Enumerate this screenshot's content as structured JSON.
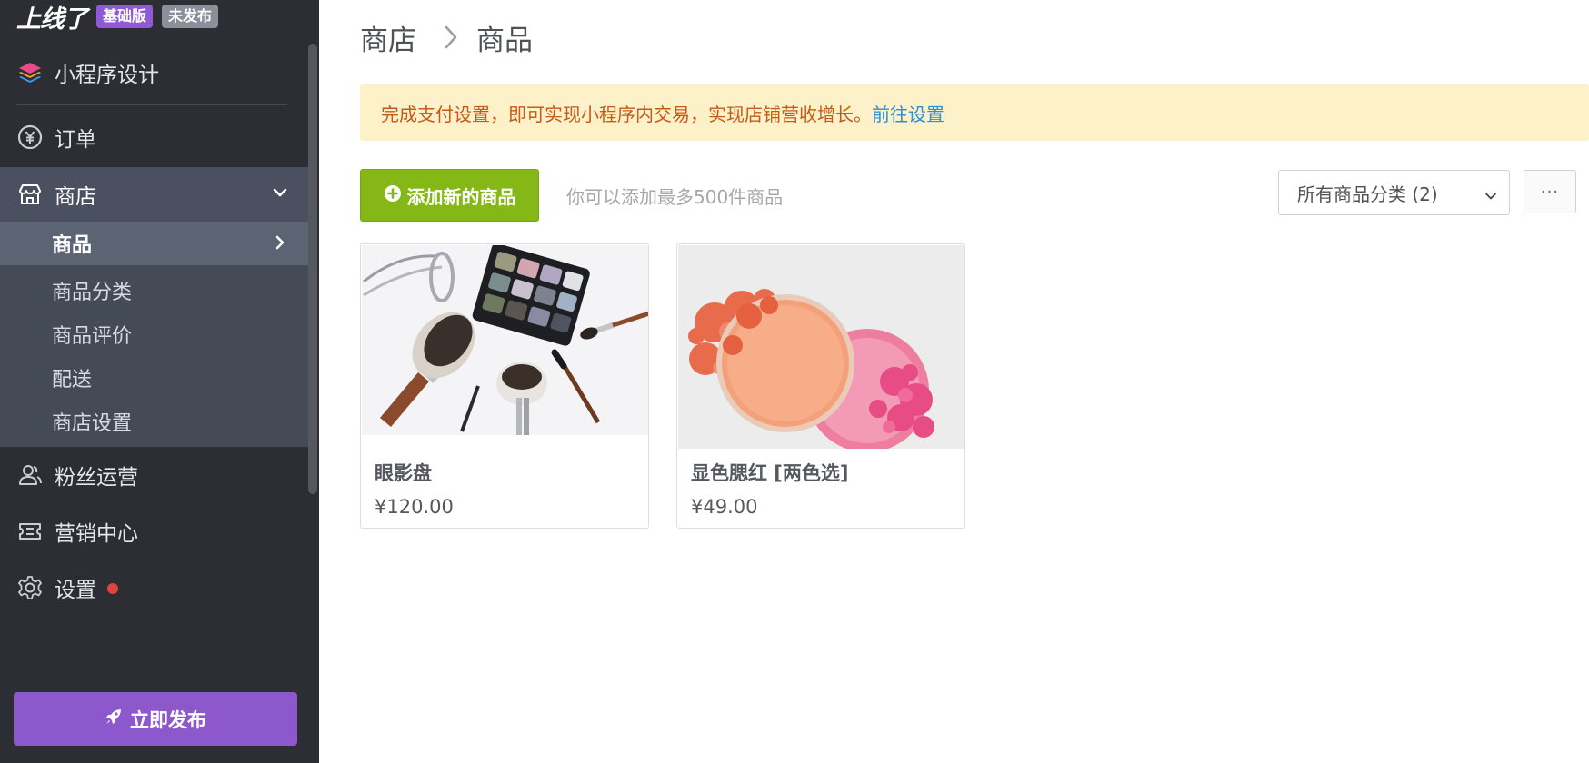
{
  "brand": {
    "logo_text": "上线了",
    "plan_badge": "基础版",
    "status_badge": "未发布"
  },
  "sidebar": {
    "items": [
      {
        "label": "小程序设计",
        "icon": "layers-icon"
      },
      {
        "label": "订单",
        "icon": "yen-circle-icon"
      },
      {
        "label": "商店",
        "icon": "store-icon"
      },
      {
        "label": "粉丝运营",
        "icon": "users-icon"
      },
      {
        "label": "营销中心",
        "icon": "ticket-icon"
      },
      {
        "label": "设置",
        "icon": "gear-icon"
      }
    ],
    "shop_subitems": [
      "商品",
      "商品分类",
      "商品评价",
      "配送",
      "商店设置"
    ],
    "publish_label": "立即发布"
  },
  "breadcrumb": {
    "parent": "商店",
    "current": "商品"
  },
  "alert": {
    "text": "完成支付设置，即可实现小程序内交易，实现店铺营收增长。",
    "link": "前往设置"
  },
  "toolbar": {
    "add_label": "添加新的商品",
    "hint": "你可以添加最多500件商品",
    "category_select": "所有商品分类 (2)",
    "more_label": "···"
  },
  "products": [
    {
      "name": "眼影盘",
      "price": "¥120.00"
    },
    {
      "name": "显色腮红 [两色选]",
      "price": "¥49.00"
    }
  ],
  "colors": {
    "sidebar_bg": "#2d2e33",
    "accent_purple": "#8c58cc",
    "add_green": "#85b817",
    "alert_bg": "#fdf1c9",
    "alert_text": "#c65a17",
    "link_blue": "#2a90d6",
    "notice_red": "#e2443c"
  }
}
